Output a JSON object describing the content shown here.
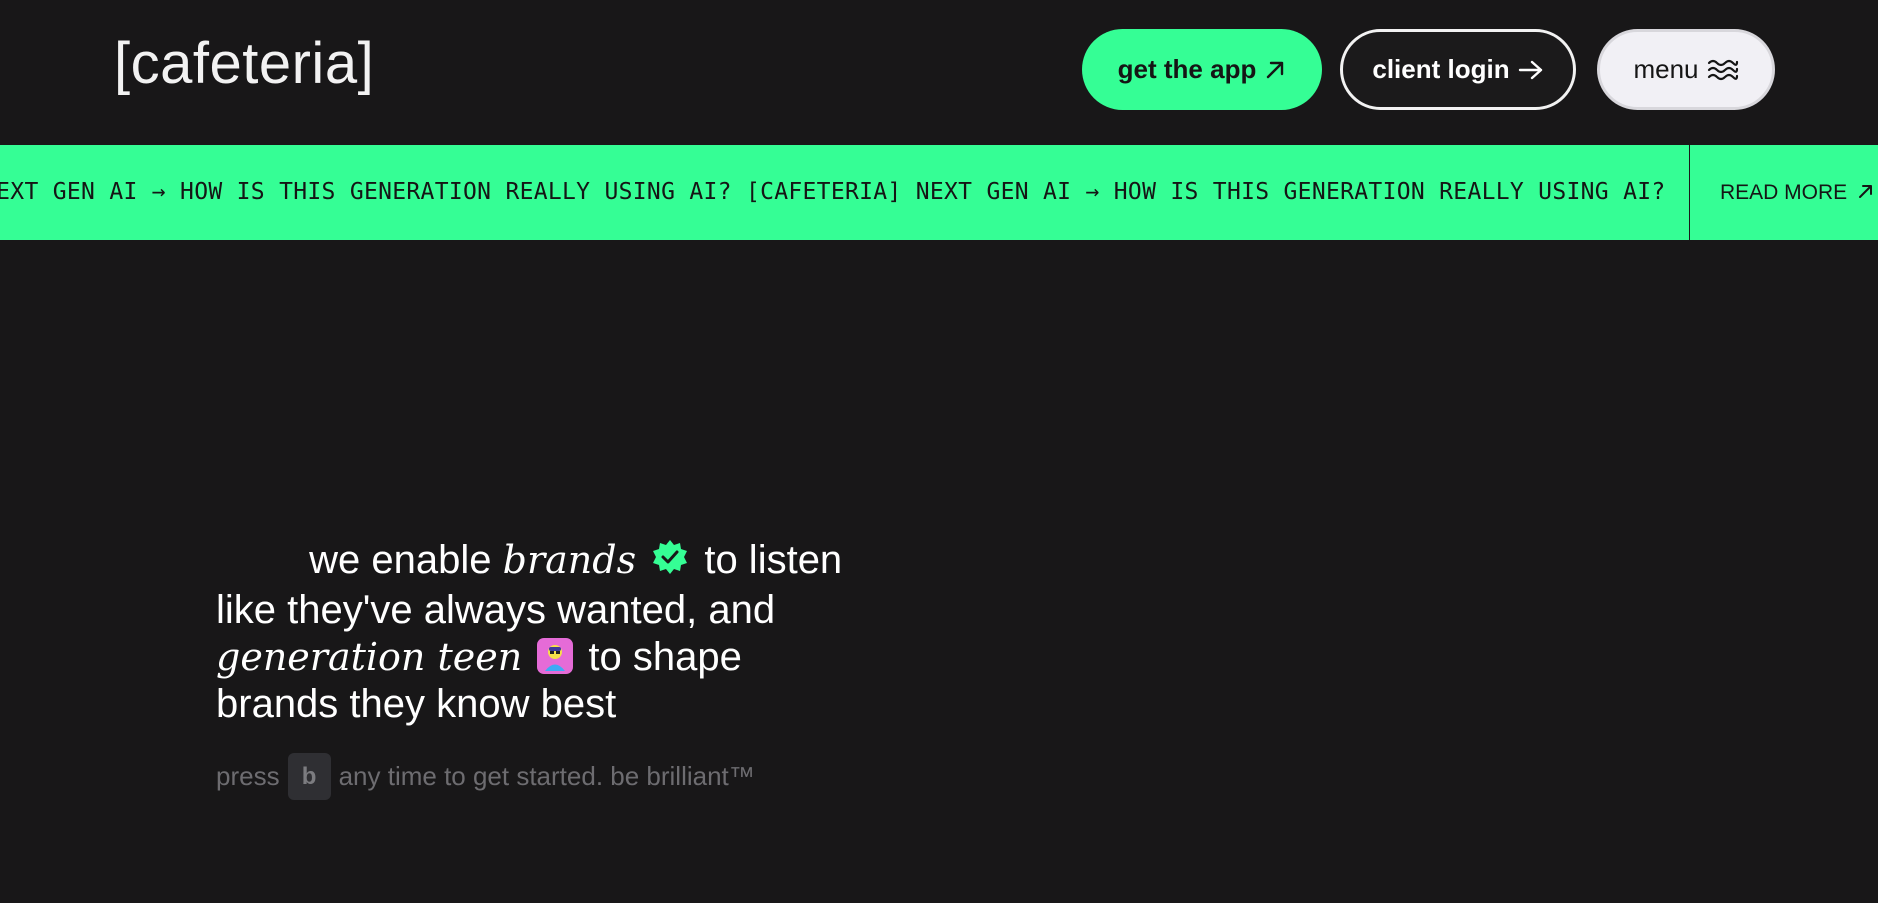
{
  "header": {
    "logo": "[cafeteria]",
    "get_app_label": "get the app",
    "client_login_label": "client login",
    "menu_label": "menu"
  },
  "ticker": {
    "text": "NEXT GEN AI → HOW IS THIS GENERATION REALLY USING AI? [CAFETERIA] NEXT GEN AI → HOW IS THIS GENERATION REALLY USING AI?",
    "read_more_label": "READ MORE"
  },
  "hero": {
    "line1_a": "we enable",
    "line1_b": "brands",
    "line1_c": "to listen",
    "line2": "like they've always wanted, and",
    "line3_a": "generation teen",
    "line3_b": "to shape",
    "line4": "brands they know best"
  },
  "subline": {
    "before": "press",
    "key": "b",
    "after": "any time to get started. be brilliant™"
  },
  "colors": {
    "background": "#181718",
    "accent_green": "#35fe95",
    "menu_bg": "#f1f0f5",
    "teen_icon_bg": "#e56bd7"
  },
  "icons": {
    "get_app": "arrow-up-right-icon",
    "client_login": "arrow-right-icon",
    "menu": "wave-menu-icon",
    "read_more": "arrow-up-right-icon",
    "brands": "verified-badge-icon",
    "generation_teen": "teen-avatar-icon"
  }
}
